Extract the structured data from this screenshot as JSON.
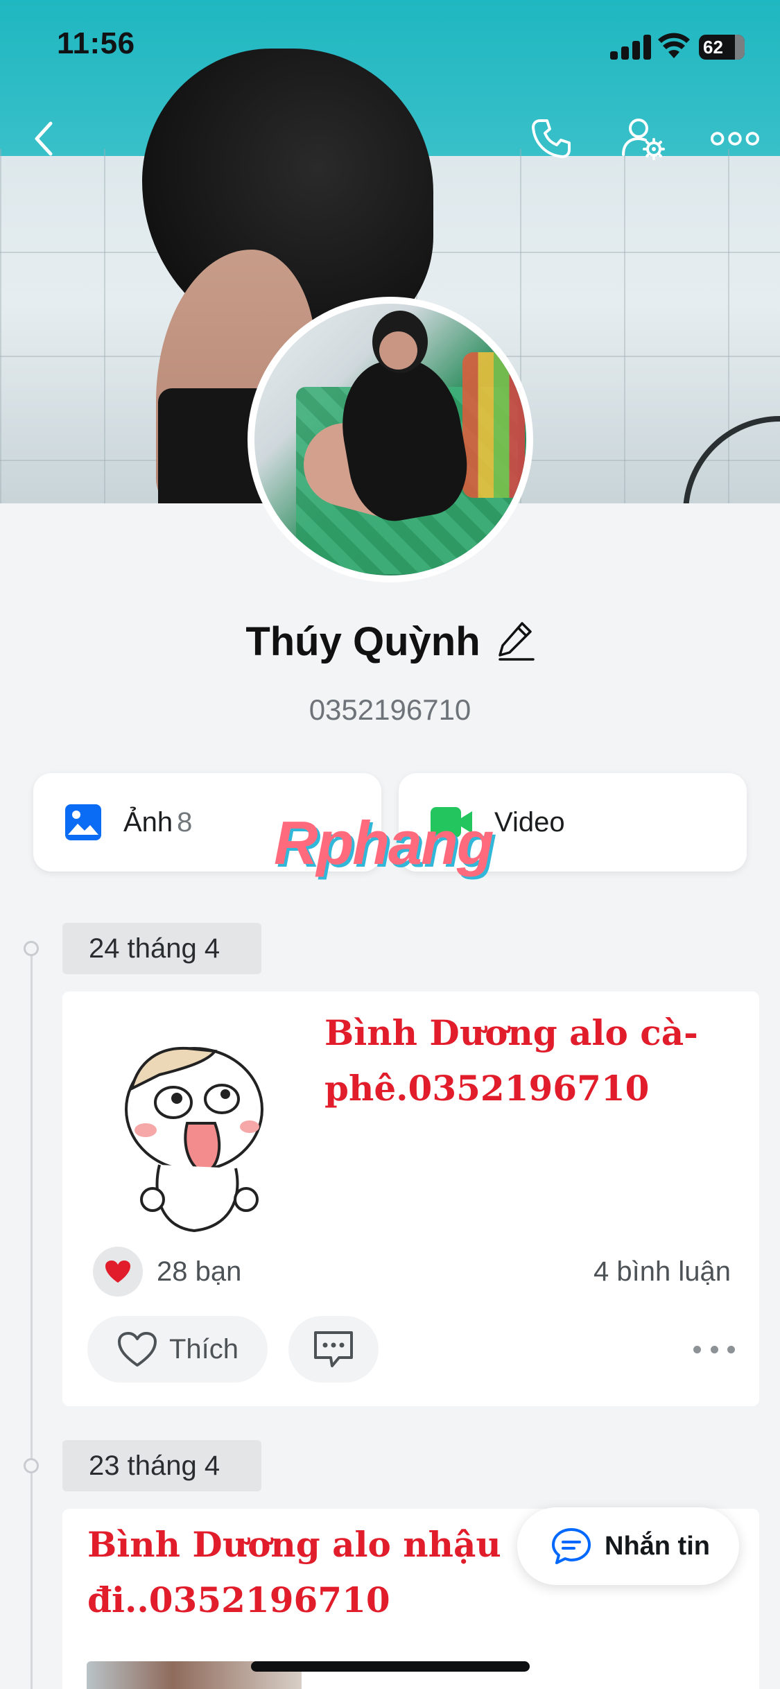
{
  "status_bar": {
    "time": "11:56",
    "battery": "62"
  },
  "cover": {
    "description_icon": "cover-photo"
  },
  "header": {
    "back_icon": "chevron-left-icon",
    "call_icon": "phone-icon",
    "settings_icon": "user-settings-icon",
    "more_icon": "more-horizontal-icon"
  },
  "profile": {
    "name": "Thúy Quỳnh",
    "phone": "0352196710",
    "edit_icon": "pencil-icon"
  },
  "media": {
    "photos_label": "Ảnh",
    "photos_count": "8",
    "video_label": "Video"
  },
  "watermark": "Rphang",
  "timeline": [
    {
      "date": "24 tháng 4",
      "caption": "Bình Dương alo cà-phê.0352196710",
      "reaction_count": "28 bạn",
      "comment_count": "4 bình luận",
      "like_label": "Thích"
    },
    {
      "date": "23 tháng 4",
      "caption": "Bình Dương alo nhậu đi..0352196710"
    }
  ],
  "fab": {
    "label": "Nhắn tin"
  },
  "colors": {
    "accent_blue": "#0068ff",
    "caption_red": "#e11d2b",
    "video_green": "#22c55e"
  }
}
